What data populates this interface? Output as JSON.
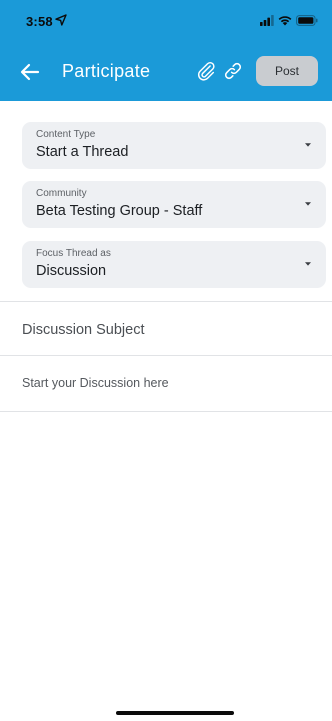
{
  "status_bar": {
    "time": "3:58",
    "icons": [
      "location-arrow-icon",
      "signal-icon",
      "wifi-icon",
      "battery-icon"
    ]
  },
  "header": {
    "title": "Participate",
    "post_label": "Post",
    "icons": [
      "back-arrow-icon",
      "paperclip-icon",
      "link-icon"
    ]
  },
  "form": {
    "content_type": {
      "label": "Content Type",
      "value": "Start a Thread"
    },
    "community": {
      "label": "Community",
      "value": "Beta Testing Group - Staff"
    },
    "focus_thread": {
      "label": "Focus Thread as",
      "value": "Discussion"
    },
    "subject_placeholder": "Discussion Subject",
    "body_placeholder": "Start your Discussion here"
  },
  "colors": {
    "header_bg": "#1b9ad8",
    "field_bg": "#eef0f3",
    "post_button_bg": "#c9ccd0"
  }
}
